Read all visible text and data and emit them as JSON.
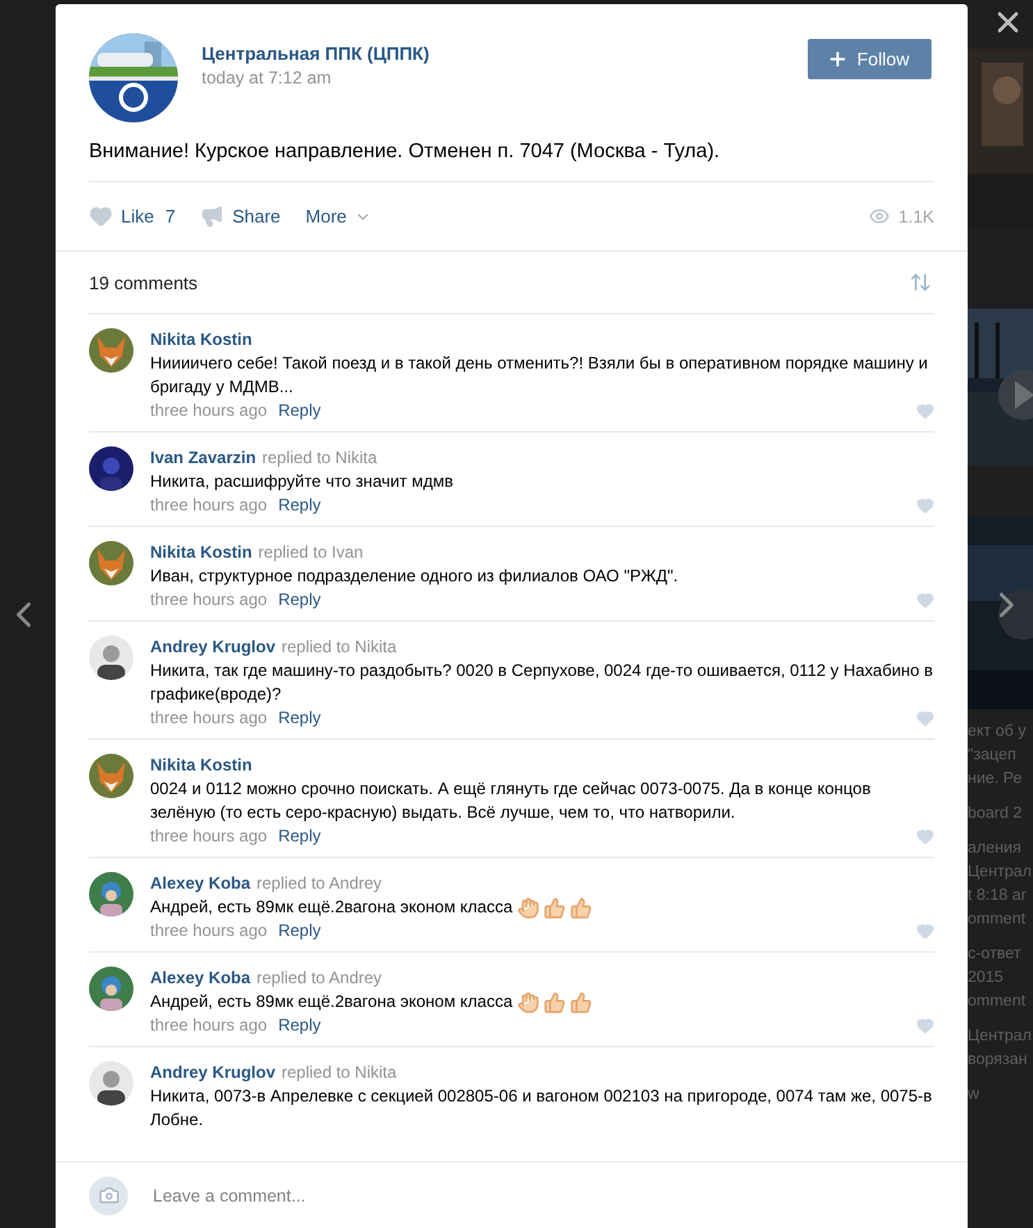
{
  "post": {
    "author": "Центральная ППК (ЦППК)",
    "time": "today at 7:12 am",
    "follow_label": "Follow",
    "text": "Внимание! Курское направление. Отменен п. 7047 (Москва - Тула).",
    "like_label": "Like",
    "like_count": "7",
    "share_label": "Share",
    "more_label": "More",
    "views": "1.1K"
  },
  "comments_header": {
    "count_label": "19 comments"
  },
  "comments": [
    {
      "author": "Nikita Kostin",
      "text": "Ниииичего себе! Такой поезд и в такой день отменить?! Взяли бы в оперативном порядке машину и бригаду у МДМВ...",
      "time": "three hours ago",
      "reply_label": "Reply"
    },
    {
      "author": "Ivan Zavarzin",
      "reply_note": "replied to Nikita",
      "text": "Никита, расшифруйте что значит мдмв",
      "time": "three hours ago",
      "reply_label": "Reply"
    },
    {
      "author": "Nikita Kostin",
      "reply_note": "replied to Ivan",
      "text": "Иван, структурное подразделение одного из филиалов ОАО \"РЖД\".",
      "time": "three hours ago",
      "reply_label": "Reply"
    },
    {
      "author": "Andrey Kruglov",
      "reply_note": "replied to Nikita",
      "text": "Никита, так где машину-то раздобыть? 0020 в Серпухове, 0024 где-то ошивается, 0112 у Нахабино в графике(вроде)?",
      "time": "three hours ago",
      "reply_label": "Reply"
    },
    {
      "author": "Nikita Kostin",
      "text": "0024 и 0112 можно срочно поискать. А ещё глянуть где сейчас 0073-0075. Да в конце концов зелёную (то есть серо-красную) выдать. Всё лучше, чем то, что натворили.",
      "time": "three hours ago",
      "reply_label": "Reply"
    },
    {
      "author": "Alexey Koba",
      "reply_note": "replied to Andrey",
      "text": "Андрей, есть 89мк ещё.2вагона эконом класса",
      "reactions": [
        {
          "kind": "ok"
        },
        {
          "kind": "thumbs_up"
        },
        {
          "kind": "thumbs_up"
        }
      ],
      "time": "three hours ago",
      "reply_label": "Reply"
    },
    {
      "author": "Alexey Koba",
      "reply_note": "replied to Andrey",
      "text": "Андрей, есть 89мк ещё.2вагона эконом класса",
      "reactions": [
        {
          "kind": "ok"
        },
        {
          "kind": "thumbs_up"
        },
        {
          "kind": "thumbs_up"
        }
      ],
      "time": "three hours ago",
      "reply_label": "Reply"
    },
    {
      "author": "Andrey Kruglov",
      "reply_note": "replied to Nikita",
      "text": "Никита, 0073-в Апрелевке с секцией 002805-06 и вагоном 002103 на пригороде, 0074 там же, 0075-в Лобне."
    }
  ],
  "composer": {
    "placeholder": "Leave a comment..."
  },
  "background": {
    "groups": [
      {
        "lines": [
          "ект об у",
          "\"зацеп",
          "ние. Ре"
        ]
      },
      {
        "lines": [
          "board 2"
        ]
      },
      {
        "lines": [
          "аления",
          "Централ",
          "t 8:18 ar",
          "omment"
        ]
      },
      {
        "lines": [
          "с-ответ",
          "2015",
          "omment"
        ]
      },
      {
        "lines": [
          "Централ",
          "ворязан"
        ]
      },
      {
        "lines": [
          "w"
        ]
      }
    ]
  }
}
